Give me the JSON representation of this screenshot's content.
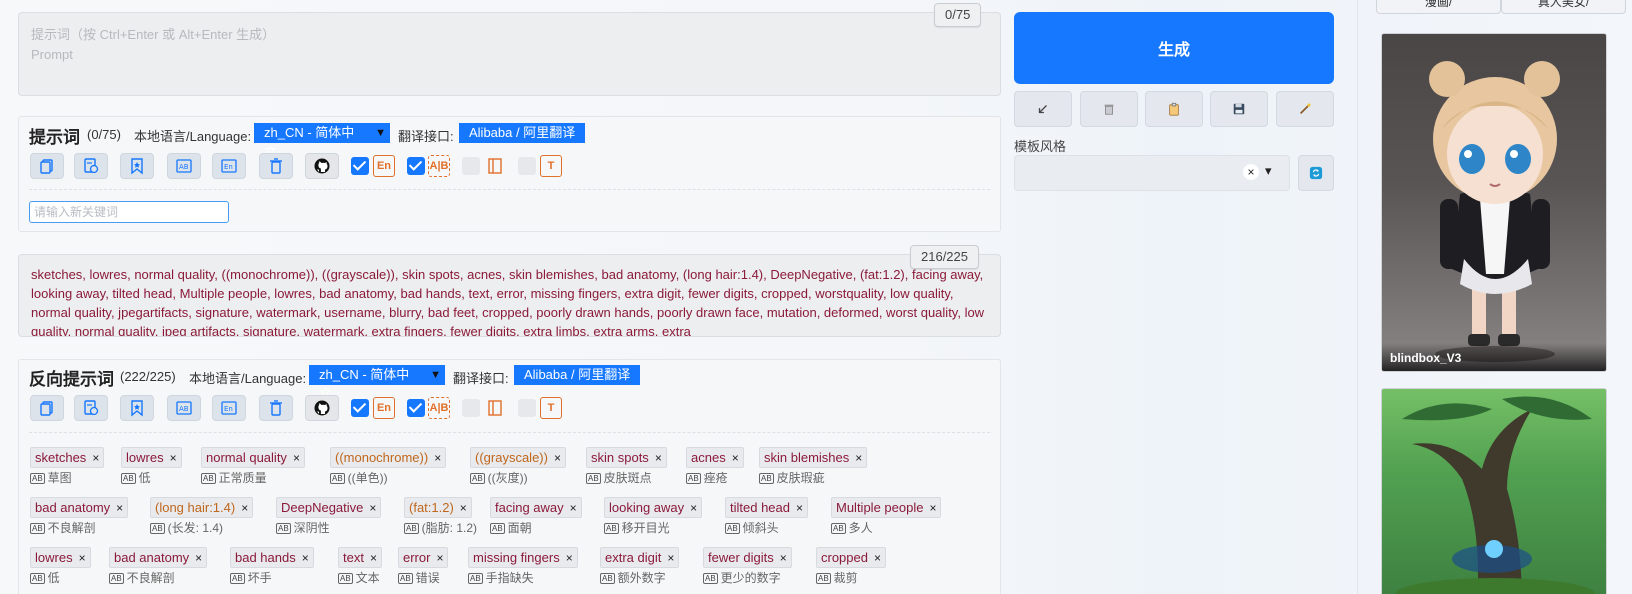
{
  "prompt": {
    "placeholder_line1": "提示词（按 Ctrl+Enter 或 Alt+Enter 生成）",
    "placeholder_line2": "Prompt",
    "counter": "0/75",
    "title": "提示词",
    "count": "(0/75)",
    "lang_label": "本地语言/Language:",
    "lang_value": "zh_CN - 简体中文",
    "trans_label": "翻译接口:",
    "trans_value": "Alibaba / 阿里翻译",
    "keyword_placeholder": "请输入新关键词"
  },
  "negative": {
    "counter": "216/225",
    "text": "sketches, lowres, normal quality, ((monochrome)), ((grayscale)), skin spots, acnes, skin blemishes, bad anatomy, (long hair:1.4), DeepNegative, (fat:1.2), facing away, looking away, tilted head, Multiple people, lowres, bad anatomy, bad hands, text, error, missing fingers, extra digit, fewer digits, cropped, worstquality, low quality, normal quality, jpegartifacts, signature, watermark, username, blurry, bad feet, cropped, poorly drawn hands, poorly drawn face, mutation, deformed, worst quality, low quality, normal quality, jpeg artifacts, signature, watermark, extra fingers, fewer digits, extra limbs, extra arms, extra",
    "title": "反向提示词",
    "count": "(222/225)",
    "lang_label": "本地语言/Language:",
    "lang_value": "zh_CN - 简体中文",
    "trans_label": "翻译接口:",
    "trans_value": "Alibaba / 阿里翻译"
  },
  "toolbar_icons": [
    "copy-icon",
    "history-icon",
    "bookmark-icon",
    "translate-icon",
    "english-icon",
    "trash-icon",
    "github-icon",
    "auto-english-checkbox",
    "auto-translate-checkbox",
    "toggle-panel-checkbox",
    "text-mode-checkbox"
  ],
  "toolbar_glyphs": {
    "en": "En",
    "ab": "A|B",
    "t": "T"
  },
  "tags_row1": [
    {
      "text": "sketches",
      "tr": "草图",
      "gold": false
    },
    {
      "text": "lowres",
      "tr": "低",
      "gold": false
    },
    {
      "text": "normal quality",
      "tr": "正常质量",
      "gold": false
    },
    {
      "text": "((monochrome))",
      "tr": "((单色))",
      "gold": true
    },
    {
      "text": "((grayscale))",
      "tr": "((灰度))",
      "gold": true
    },
    {
      "text": "skin spots",
      "tr": "皮肤斑点",
      "gold": false
    },
    {
      "text": "acnes",
      "tr": "痤疮",
      "gold": false
    },
    {
      "text": "skin blemishes",
      "tr": "皮肤瑕疵",
      "gold": false
    }
  ],
  "tags_row2": [
    {
      "text": "bad anatomy",
      "tr": "不良解剖",
      "gold": false
    },
    {
      "text": "(long hair:1.4)",
      "tr": "(长发: 1.4)",
      "gold": true
    },
    {
      "text": "DeepNegative",
      "tr": "深阴性",
      "gold": false
    },
    {
      "text": "(fat:1.2)",
      "tr": "(脂肪: 1.2)",
      "gold": true
    },
    {
      "text": "facing away",
      "tr": "面朝",
      "gold": false
    },
    {
      "text": "looking away",
      "tr": "移开目光",
      "gold": false
    },
    {
      "text": "tilted head",
      "tr": "倾斜头",
      "gold": false
    },
    {
      "text": "Multiple people",
      "tr": "多人",
      "gold": false
    }
  ],
  "tags_row3": [
    {
      "text": "lowres",
      "tr": "低",
      "gold": false
    },
    {
      "text": "bad anatomy",
      "tr": "不良解剖",
      "gold": false
    },
    {
      "text": "bad hands",
      "tr": "坏手",
      "gold": false
    },
    {
      "text": "text",
      "tr": "文本",
      "gold": false
    },
    {
      "text": "error",
      "tr": "错误",
      "gold": false
    },
    {
      "text": "missing fingers",
      "tr": "手指缺失",
      "gold": false
    },
    {
      "text": "extra digit",
      "tr": "额外数字",
      "gold": false
    },
    {
      "text": "fewer digits",
      "tr": "更少的数字",
      "gold": false
    },
    {
      "text": "cropped",
      "tr": "裁剪",
      "gold": false
    }
  ],
  "tag_close_glyph": "×",
  "tag_translate_glyph": "AB",
  "right": {
    "generate_label": "生成",
    "small_buttons": [
      "↙",
      "🗑",
      "📋",
      "💾",
      "🪄"
    ],
    "style_label": "模板风格",
    "style_value": "",
    "clear_glyph": "×",
    "dropdown_glyph": "▾"
  },
  "gallery": {
    "tabs": [
      "漫画/",
      "真人美女/"
    ],
    "cards": [
      {
        "caption": "blindbox_V3"
      },
      {
        "caption": ""
      }
    ]
  },
  "colors": {
    "accent": "#1677ff",
    "tag_text": "#8b1a3a",
    "tag_weighted": "#c0671c",
    "icon_orange": "#e0702a"
  }
}
